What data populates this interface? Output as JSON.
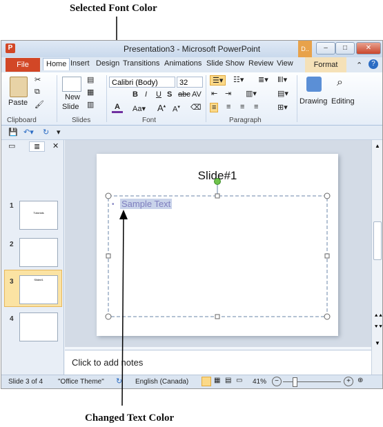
{
  "annotations": {
    "top": "Selected Font Color",
    "bottom": "Changed Text Color"
  },
  "window": {
    "title": "Presentation3 - Microsoft PowerPoint",
    "context_tab_short": "D..",
    "app_icon": "P"
  },
  "tabs": {
    "file": "File",
    "items": [
      "Home",
      "Insert",
      "Design",
      "Transitions",
      "Animations",
      "Slide Show",
      "Review",
      "View"
    ],
    "format": "Format"
  },
  "ribbon": {
    "clipboard": {
      "paste": "Paste",
      "label": "Clipboard"
    },
    "slides": {
      "new_slide_1": "New",
      "new_slide_2": "Slide",
      "label": "Slides"
    },
    "font": {
      "name": "Calibri (Body)",
      "size": "32",
      "label": "Font",
      "color": "#7030a0"
    },
    "paragraph": {
      "label": "Paragraph"
    },
    "drawing": "Drawing",
    "editing": "Editing"
  },
  "slides": [
    {
      "num": "1",
      "mini": "Tutorials"
    },
    {
      "num": "2",
      "mini": ""
    },
    {
      "num": "3",
      "mini": "Slide#1"
    },
    {
      "num": "4",
      "mini": ""
    }
  ],
  "slide": {
    "title": "Slide#1",
    "bullet_text": "Sample Text",
    "bullet_color": "#7f7fbf",
    "highlight": "#c9d3ea"
  },
  "notes": {
    "placeholder": "Click to add notes"
  },
  "status": {
    "slide_info": "Slide 3 of 4",
    "theme": "\"Office Theme\"",
    "language": "English (Canada)",
    "zoom": "41%"
  },
  "colors": {
    "file_tab": "#d24726",
    "ribbon_accent": "#aac0dc"
  }
}
